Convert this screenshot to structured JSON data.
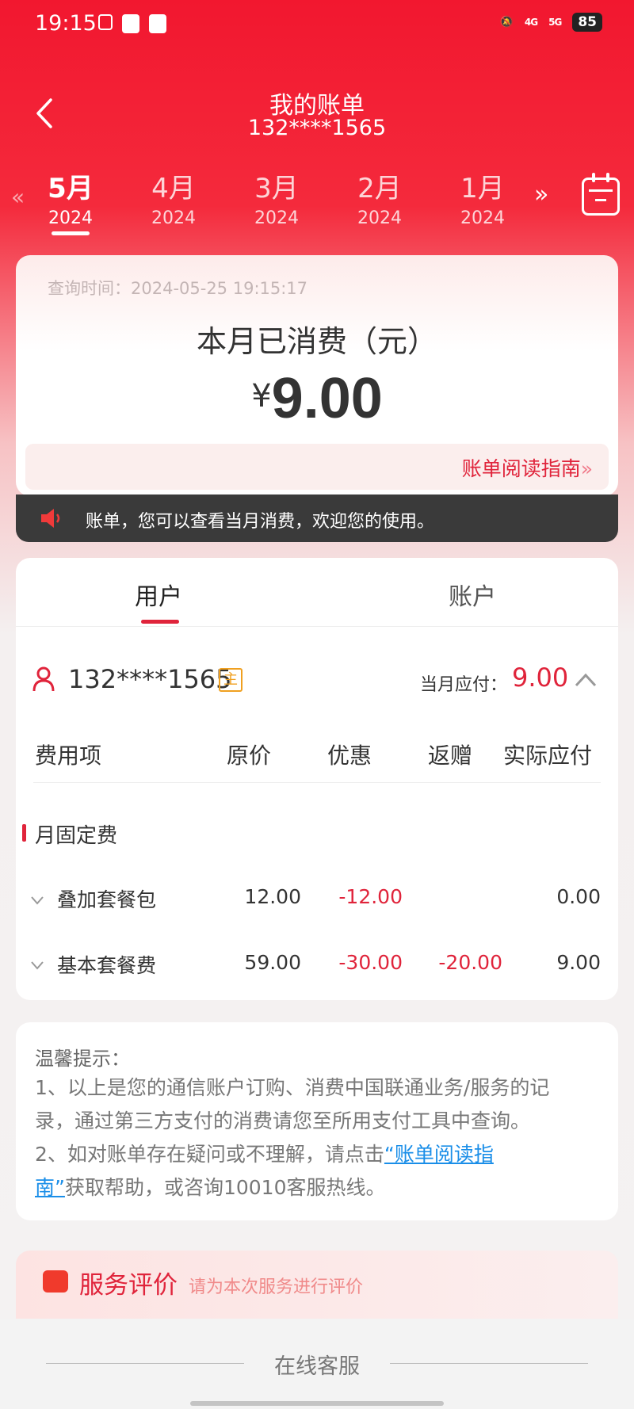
{
  "status_bar": {
    "time": "19:15",
    "network_1": "4G",
    "network_2": "5G",
    "battery": "85"
  },
  "header": {
    "title": "我的账单",
    "phone": "132****1565"
  },
  "months": [
    {
      "month": "5月",
      "year": "2024"
    },
    {
      "month": "4月",
      "year": "2024"
    },
    {
      "month": "3月",
      "year": "2024"
    },
    {
      "month": "2月",
      "year": "2024"
    },
    {
      "month": "1月",
      "year": "2024"
    }
  ],
  "summary": {
    "query_time": "查询时间：2024-05-25 19:15:17",
    "spent_label": "本月已消费（元）",
    "currency": "¥",
    "amount": "9.00",
    "guide_link": "账单阅读指南"
  },
  "notice": {
    "text": "账单，您可以查看当月消费，欢迎您的使用。"
  },
  "tabs": {
    "user": "用户",
    "account": "账户"
  },
  "user": {
    "number": "132****1565",
    "badge": "主",
    "due_label": "当月应付：",
    "due_value": "9.00"
  },
  "table": {
    "headers": [
      "费用项",
      "原价",
      "优惠",
      "返赠",
      "实际应付"
    ],
    "section": "月固定费",
    "rows": [
      {
        "name": "叠加套餐包",
        "original": "12.00",
        "discount": "-12.00",
        "rebate": "",
        "actual": "0.00"
      },
      {
        "name": "基本套餐费",
        "original": "59.00",
        "discount": "-30.00",
        "rebate": "-20.00",
        "actual": "9.00"
      }
    ]
  },
  "tips": {
    "title": "温馨提示：",
    "line1": "1、以上是您的通信账户订购、消费中国联通业务/服务的记",
    "line2": "录，通过第三方支付的消费请您至所用支付工具中查询。",
    "line3_pre": "2、如对账单存在疑问或不理解，请点击",
    "line3_link": "“账单阅读指",
    "line4_link": "南”",
    "line4_post": "获取帮助，或咨询10010客服热线。"
  },
  "rating": {
    "title": "服务评价",
    "subtitle": "请为本次服务进行评价"
  },
  "bottom": {
    "online_service": "在线客服"
  },
  "colors": {
    "brand_red": "#e0243b",
    "header_red": "#f2172f",
    "link_blue": "#1a8ee8"
  }
}
